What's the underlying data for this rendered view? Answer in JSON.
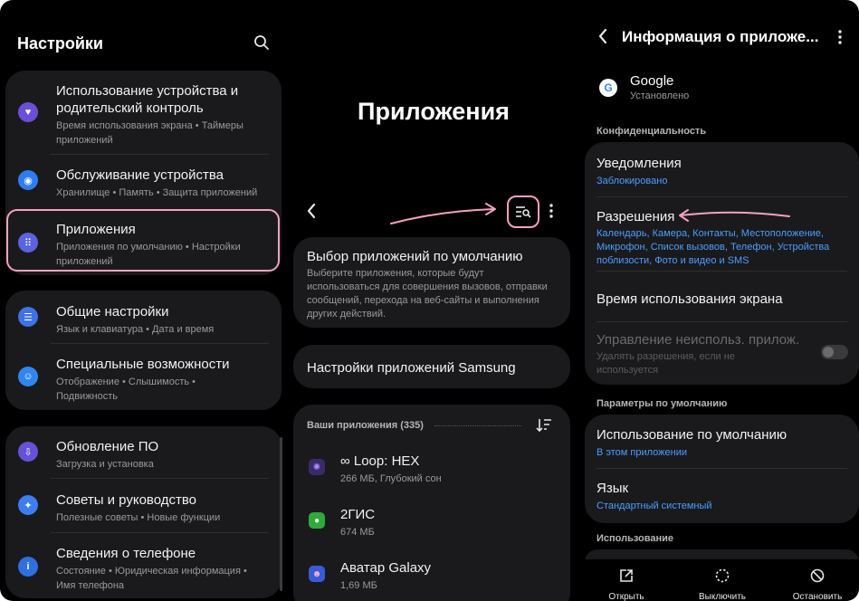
{
  "settings": {
    "title": "Настройки",
    "groups": [
      {
        "items": [
          {
            "title_1": "Использование устройства и",
            "title_2": "родительский контроль",
            "sub_1": "Время использования экрана • Таймеры",
            "sub_2": "приложений",
            "icon": "heart-shield-icon",
            "color": "#6b4fd8"
          },
          {
            "title_1": "Обслуживание устройства",
            "sub_1": "Хранилище • Память • Защита приложений",
            "icon": "device-care-icon",
            "color": "#2e7df0"
          },
          {
            "title_1": "Приложения",
            "sub_1": "Приложения по умолчанию • Настройки",
            "sub_2": "приложений",
            "icon": "apps-grid-icon",
            "color": "#5a63e0"
          }
        ]
      },
      {
        "items": [
          {
            "title_1": "Общие настройки",
            "sub_1": "Язык и клавиатура • Дата и время",
            "icon": "sliders-icon",
            "color": "#3f72e6"
          },
          {
            "title_1": "Специальные возможности",
            "sub_1": "Отображение • Слышимость •",
            "sub_2": "Подвижность",
            "icon": "accessibility-icon",
            "color": "#2f86f0"
          }
        ]
      },
      {
        "items": [
          {
            "title_1": "Обновление ПО",
            "sub_1": "Загрузка и установка",
            "icon": "software-update-icon",
            "color": "#6652d6"
          },
          {
            "title_1": "Советы и руководство",
            "sub_1": "Полезные советы • Новые функции",
            "icon": "lightbulb-icon",
            "color": "#3e7cf2"
          },
          {
            "title_1": "Сведения о телефоне",
            "sub_1": "Состояние • Юридическая информация •",
            "sub_2": "Имя телефона",
            "icon": "info-icon",
            "color": "#2f6fe0"
          }
        ]
      }
    ]
  },
  "apps": {
    "title": "Приложения",
    "default_apps": {
      "title": "Выбор приложений по умолчанию",
      "desc_1": "Выберите приложения, которые будут",
      "desc_2": "использоваться для совершения вызовов, отправки",
      "desc_3": "сообщений, перехода на веб-сайты и выполнения",
      "desc_4": "других действий."
    },
    "samsung_settings": "Настройки приложений Samsung",
    "your_apps_label": "Ваши приложения (335)",
    "list": [
      {
        "name": "∞ Loop: HEX",
        "meta": "266 МБ, Глубокий сон",
        "icon": "loop-hex-icon",
        "color": "#3a2a6a"
      },
      {
        "name": "2ГИС",
        "meta": "674 МБ",
        "icon": "2gis-icon",
        "color": "#2eaa3c"
      },
      {
        "name": "Аватар Galaxy",
        "meta": "1,69 МБ",
        "icon": "avatar-galaxy-icon",
        "color": "#3a5bd8"
      }
    ]
  },
  "app_info": {
    "header": "Информация о приложе...",
    "app_name": "Google",
    "app_status": "Установлено",
    "section_privacy": "Конфиденциальность",
    "notifications": {
      "title": "Уведомления",
      "value": "Заблокировано"
    },
    "permissions": {
      "title": "Разрешения",
      "value_1": "Календарь, Камера, Контакты, Местоположение,",
      "value_2": "Микрофон, Список вызовов, Телефон, Устройства",
      "value_3": "поблизости, Фото и видео и SMS"
    },
    "screen_time": "Время использования экрана",
    "unused": {
      "title": "Управление неиспольз. прилож.",
      "sub_1": "Удалять разрешения, если не",
      "sub_2": "используется"
    },
    "section_defaults": "Параметры по умолчанию",
    "default_use": {
      "title": "Использование по умолчанию",
      "value": "В этом приложении"
    },
    "language": {
      "title": "Язык",
      "value": "Стандартный системный"
    },
    "section_usage": "Использование",
    "bottom": {
      "open": "Открыть",
      "disable": "Выключить",
      "force_stop": "Остановить"
    }
  },
  "colors": {
    "highlight": "#f4a2c0",
    "link": "#4d9dff",
    "card": "#1a1a1c"
  }
}
